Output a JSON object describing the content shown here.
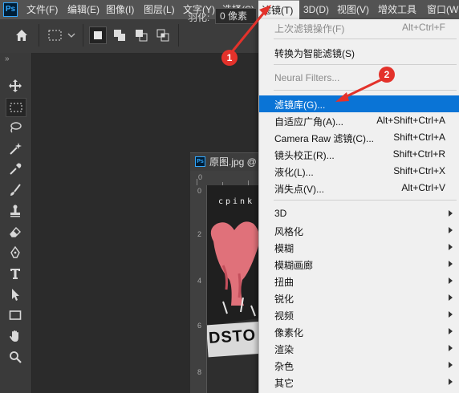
{
  "menu": {
    "app_logo": "Ps",
    "items": [
      "文件(F)",
      "编辑(E)",
      "图像(I)",
      "图层(L)",
      "文字(Y)",
      "选择(S)",
      "滤镜(T)",
      "3D(D)",
      "视图(V)",
      "增效工具",
      "窗口(W"
    ]
  },
  "options": {
    "feather_label": "羽化:",
    "feather_value": "0 像素"
  },
  "toolbar": {
    "collapse": "»",
    "tools": [
      "move-icon",
      "marquee-icon",
      "lasso-icon",
      "magic-wand-icon",
      "eyedropper-icon",
      "brush-icon",
      "stamp-icon",
      "eraser-icon",
      "pen-icon",
      "type-icon",
      "path-select-icon",
      "rectangle-icon",
      "hand-icon",
      "zoom-icon"
    ]
  },
  "document": {
    "icon": "Ps",
    "title": "原图.jpg @",
    "ruler_top": [
      "0"
    ],
    "ruler_left": [
      "0",
      "2",
      "4",
      "6",
      "8",
      "1"
    ],
    "image_text_top": "cpink",
    "image_text_shirt": "DSTO"
  },
  "filter_menu": {
    "items": [
      {
        "label": "上次滤镜操作(F)",
        "shortcut": "Alt+Ctrl+F",
        "disabled": true
      },
      {
        "label": "转换为智能滤镜(S)",
        "shortcut": ""
      },
      {
        "label": "Neural Filters...",
        "shortcut": "",
        "disabled": true
      },
      {
        "label": "滤镜库(G)...",
        "shortcut": "",
        "highlight": true
      },
      {
        "label": "自适应广角(A)...",
        "shortcut": "Alt+Shift+Ctrl+A"
      },
      {
        "label": "Camera Raw 滤镜(C)...",
        "shortcut": "Shift+Ctrl+A"
      },
      {
        "label": "镜头校正(R)...",
        "shortcut": "Shift+Ctrl+R"
      },
      {
        "label": "液化(L)...",
        "shortcut": "Shift+Ctrl+X"
      },
      {
        "label": "消失点(V)...",
        "shortcut": "Alt+Ctrl+V"
      },
      {
        "label": "3D",
        "submenu": true
      },
      {
        "label": "风格化",
        "submenu": true
      },
      {
        "label": "模糊",
        "submenu": true
      },
      {
        "label": "模糊画廊",
        "submenu": true
      },
      {
        "label": "扭曲",
        "submenu": true
      },
      {
        "label": "锐化",
        "submenu": true
      },
      {
        "label": "视频",
        "submenu": true
      },
      {
        "label": "像素化",
        "submenu": true
      },
      {
        "label": "渲染",
        "submenu": true
      },
      {
        "label": "杂色",
        "submenu": true
      },
      {
        "label": "其它",
        "submenu": true
      }
    ]
  },
  "annotations": {
    "badge_1": "1",
    "badge_2": "2",
    "arrow_color": "#e3322b"
  },
  "colors": {
    "highlight": "#0a74d6",
    "menu_bg": "#f0f0f0",
    "app_bg": "#2b2b2b"
  }
}
